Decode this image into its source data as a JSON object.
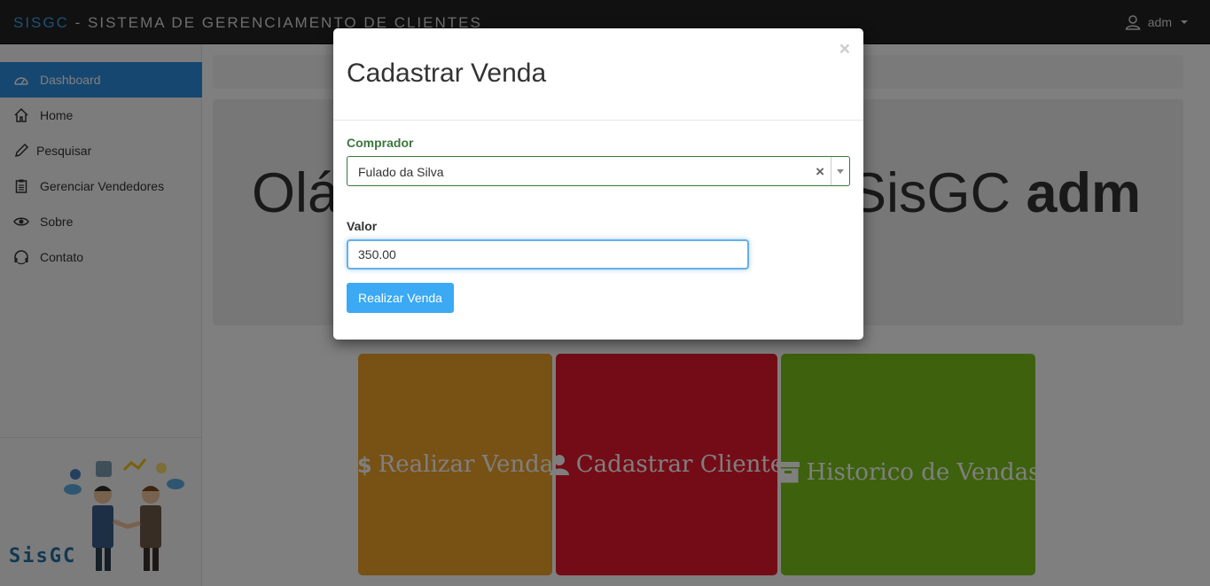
{
  "navbar": {
    "brand_accent": "SISGC",
    "brand_rest": " - SISTEMA DE GERENCIAMENTO DE CLIENTES",
    "user_label": "adm"
  },
  "sidebar": {
    "items": [
      {
        "label": "Dashboard",
        "icon": "dashboard-icon",
        "active": true
      },
      {
        "label": "Home",
        "icon": "home-icon",
        "active": false
      },
      {
        "label": "Pesquisar",
        "icon": "pencil-icon",
        "active": false
      },
      {
        "label": "Gerenciar Vendedores",
        "icon": "clipboard-icon",
        "active": false
      },
      {
        "label": "Sobre",
        "icon": "eye-icon",
        "active": false
      },
      {
        "label": "Contato",
        "icon": "headset-icon",
        "active": false
      }
    ],
    "logo_text": "SisGC"
  },
  "main": {
    "greeting_start": "Olá",
    "greeting_end": "SisGC ",
    "greeting_user": "adm",
    "tiles": [
      {
        "label": "Realizar Venda",
        "icon": "dollar-icon",
        "color": "#f1a22a"
      },
      {
        "label": "Cadastrar Cliente",
        "icon": "user-icon",
        "color": "#e8192f"
      },
      {
        "label": "Historico de Vendas",
        "icon": "archive-icon",
        "color": "#7cc21a"
      }
    ]
  },
  "modal": {
    "title": "Cadastrar Venda",
    "close": "×",
    "comprador_label": "Comprador",
    "comprador_value": "Fulado da Silva",
    "clear": "×",
    "valor_label": "Valor",
    "valor_value": "350.00",
    "submit_label": "Realizar Venda"
  },
  "colors": {
    "accent": "#2c8ee0",
    "success": "#3c763d",
    "button": "#3ba9f3"
  }
}
